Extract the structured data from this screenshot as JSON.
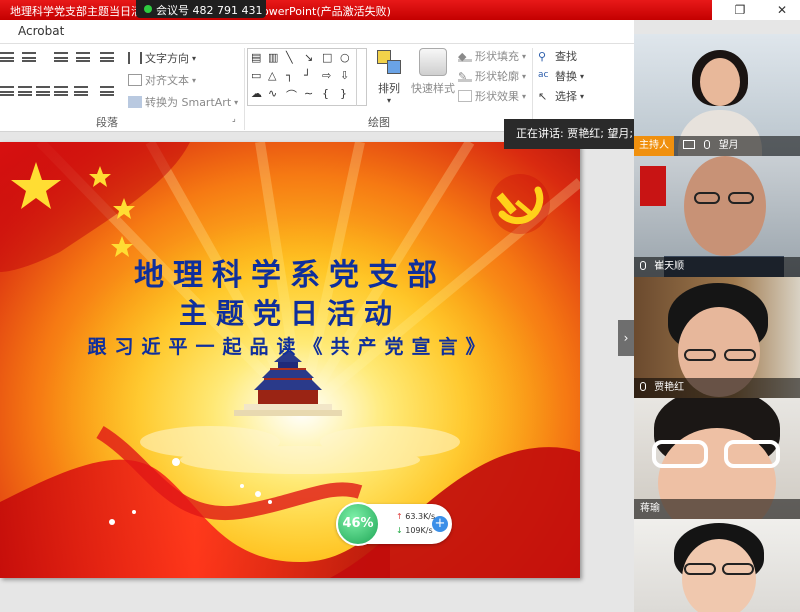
{
  "window": {
    "title": "地理科学党支部主题当日活",
    "title_suffix": "owerPoint(产品激活失败)",
    "meeting_id": "会议号 482 791 431",
    "restore_glyph": "❐",
    "close_glyph": "✕"
  },
  "menu": {
    "acrobat": "Acrobat"
  },
  "ribbon": {
    "paragraph": {
      "group_label": "段落",
      "text_direction": "文字方向",
      "align_text": "对齐文本",
      "smartart": "转换为 SmartArt"
    },
    "drawing": {
      "group_label": "绘图",
      "arrange": "排列",
      "quick_styles": "快速样式",
      "shape_fill": "形状填充",
      "shape_outline": "形状轮廓",
      "shape_effects": "形状效果"
    },
    "editing": {
      "find": "查找",
      "replace": "替换",
      "select": "选择"
    }
  },
  "slide": {
    "title1": "地理科学系党支部",
    "title2": "主题党日活动",
    "title3": "跟习近平一起品读《共产党宣言》"
  },
  "network": {
    "percent": "46%",
    "upload": "63.3K/s",
    "download": "109K/s",
    "plus": "+"
  },
  "speaking": {
    "text": "正在讲话: 贾艳红; 望月;"
  },
  "panel": {
    "collapse_glyph": "›",
    "participants": [
      {
        "name": "望月",
        "host": true,
        "host_label": "主持人"
      },
      {
        "name": "崔天顺"
      },
      {
        "name": "贾艳红"
      },
      {
        "name": "蒋瑜"
      },
      {
        "name": ""
      }
    ]
  },
  "colors": {
    "titlebar_red": "#e81919",
    "slide_title_blue": "#0f2f9c",
    "host_orange": "#f0900e",
    "network_green": "#1ea555"
  }
}
